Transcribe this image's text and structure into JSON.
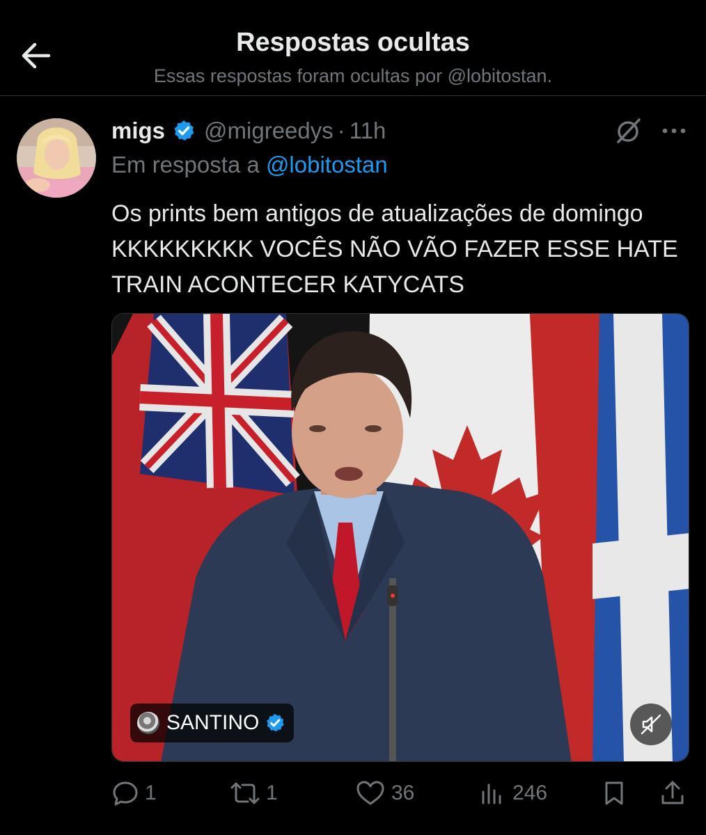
{
  "header": {
    "title": "Respostas ocultas",
    "subtitle": "Essas respostas foram ocultas por @lobitostan."
  },
  "tweet": {
    "name": "migs",
    "handle": "@migreedys",
    "separator": "·",
    "time": "11h",
    "reply_prefix": "Em resposta a ",
    "reply_handle": "@lobitostan",
    "text": "Os prints bem antigos de atualizações de domingo KKKKKKKKK VOCÊS NÃO VÃO FAZER ESSE HATE TRAIN ACONTECER KATYCATS",
    "media": {
      "credit_name": "SANTINO"
    }
  },
  "actions": {
    "replies": "1",
    "retweets": "1",
    "likes": "36",
    "views": "246"
  },
  "colors": {
    "accent": "#1d9bf0",
    "muted": "#71767b",
    "background": "#000000"
  },
  "icons": [
    "back-arrow-icon",
    "verified-badge-icon",
    "grok-icon",
    "more-icon",
    "mute-icon",
    "reply-icon",
    "retweet-icon",
    "like-icon",
    "views-icon",
    "bookmark-icon",
    "share-icon"
  ]
}
